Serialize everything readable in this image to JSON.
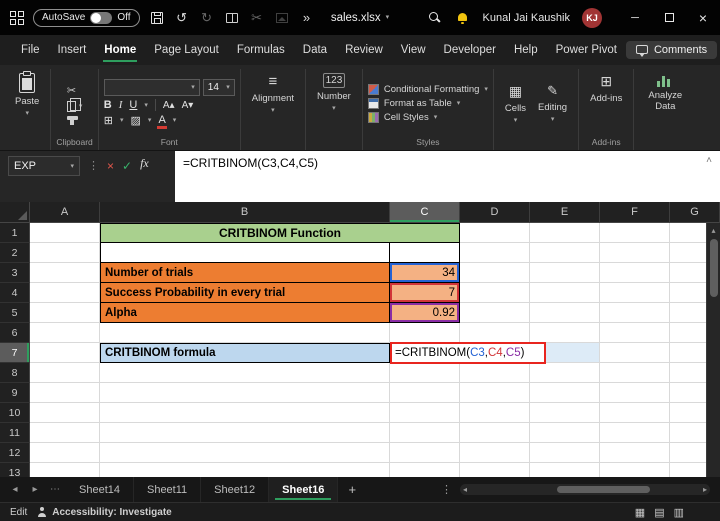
{
  "titlebar": {
    "autosave_label": "AutoSave",
    "autosave_state": "Off",
    "filename": "sales.xlsx",
    "user_name": "Kunal Jai Kaushik",
    "user_initials": "KJ"
  },
  "menubar": {
    "items": [
      "File",
      "Insert",
      "Home",
      "Page Layout",
      "Formulas",
      "Data",
      "Review",
      "View",
      "Developer",
      "Help",
      "Power Pivot"
    ],
    "active_item": "Home",
    "comments_label": "Comments"
  },
  "ribbon": {
    "paste": "Paste",
    "bold": "B",
    "italic": "I",
    "underline": "U",
    "grow_font": "A▴",
    "shrink_font": "A▾",
    "font_color_letter": "A",
    "font_name": "",
    "font_size": "14",
    "number_icon": "123",
    "alignment": "Alignment",
    "number": "Number",
    "conditional_formatting": "Conditional Formatting",
    "format_as_table": "Format as Table",
    "cell_styles": "Cell Styles",
    "cells": "Cells",
    "editing": "Editing",
    "addins_button": "Add-ins",
    "analyze_data": "Analyze Data",
    "group_labels": {
      "clipboard": "Clipboard",
      "font": "Font",
      "styles": "Styles",
      "addins": "Add-ins"
    }
  },
  "formula_bar": {
    "name_box": "EXP",
    "fx": "fx",
    "formula": "=CRITBINOM(C3,C4,C5)"
  },
  "grid": {
    "col_headers": [
      "A",
      "B",
      "C",
      "D",
      "E",
      "F",
      "G"
    ],
    "row_count": 13,
    "active_col": "C",
    "active_row": 7,
    "cells": [
      {
        "r": 1,
        "c": 1,
        "span": 2,
        "text": "CRITBINOM Function",
        "cls": "t-title"
      },
      {
        "r": 2,
        "c": 1,
        "cls": "t-blank t-left"
      },
      {
        "r": 2,
        "c": 2,
        "cls": "t-blank"
      },
      {
        "r": 3,
        "c": 1,
        "text": "Number of trials",
        "cls": "t-label"
      },
      {
        "r": 3,
        "c": 2,
        "text": "34",
        "cls": "t-value",
        "ref": "ref1_blue"
      },
      {
        "r": 4,
        "c": 1,
        "text": "Success Probability in every trial",
        "cls": "t-label"
      },
      {
        "r": 4,
        "c": 2,
        "text": "7",
        "cls": "t-value",
        "ref": "ref2_red"
      },
      {
        "r": 5,
        "c": 1,
        "text": "Alpha",
        "cls": "t-label"
      },
      {
        "r": 5,
        "c": 2,
        "text": "0.92",
        "cls": "t-value",
        "ref": "ref3_purple"
      },
      {
        "r": 7,
        "c": 1,
        "text": "CRITBINOM formula",
        "cls": "t-flabel"
      },
      {
        "r": 7,
        "c": 3,
        "cls": "t-frow"
      },
      {
        "r": 7,
        "c": 4,
        "cls": "t-frow"
      }
    ],
    "formula_cell_parts": [
      {
        "text": "=CRITBINOM(",
        "color": "#000000"
      },
      {
        "text": "C3",
        "color": "#2362d4"
      },
      {
        "text": ",",
        "color": "#000000"
      },
      {
        "text": "C4",
        "color": "#d13438"
      },
      {
        "text": ",",
        "color": "#000000"
      },
      {
        "text": "C5",
        "color": "#8a2da5"
      },
      {
        "text": ")",
        "color": "#000000"
      }
    ]
  },
  "sheet_tabs": {
    "tabs": [
      "Sheet14",
      "Sheet11",
      "Sheet12",
      "Sheet16"
    ],
    "active_tab": "Sheet16"
  },
  "status_bar": {
    "mode": "Edit",
    "accessibility": "Accessibility: Investigate"
  },
  "colors": {
    "accent_green": "#2e9e5e",
    "table_title_bg": "#A9D08E",
    "label_orange": "#ED7D31",
    "value_orange": "#F4B183",
    "formula_label_blue": "#BDD7EE",
    "formula_row_blue": "#DDEBF7",
    "annotation_red": "#e8251f",
    "ref1_blue": "#2362d4",
    "ref2_red": "#d13438",
    "ref3_purple": "#8a2da5"
  },
  "icons": {
    "dropdown": "▾",
    "undo": "↺",
    "redo": "↻",
    "cut": "✂",
    "more_chevron": "»",
    "prev": "◂",
    "next": "▸",
    "more_dots": "⋯",
    "kebab": "⋮",
    "plus": "+",
    "close": "×",
    "minimize": "─",
    "check": "✓",
    "pencil": "✎",
    "grid": "▦",
    "addins": "⊞",
    "align": "≡",
    "borders": "⊞",
    "fill": "▨",
    "up_small": "▴",
    "view_normal": "▦",
    "view_layout": "▤",
    "view_break": "▥",
    "collapse": "˄",
    "share": "↑"
  }
}
